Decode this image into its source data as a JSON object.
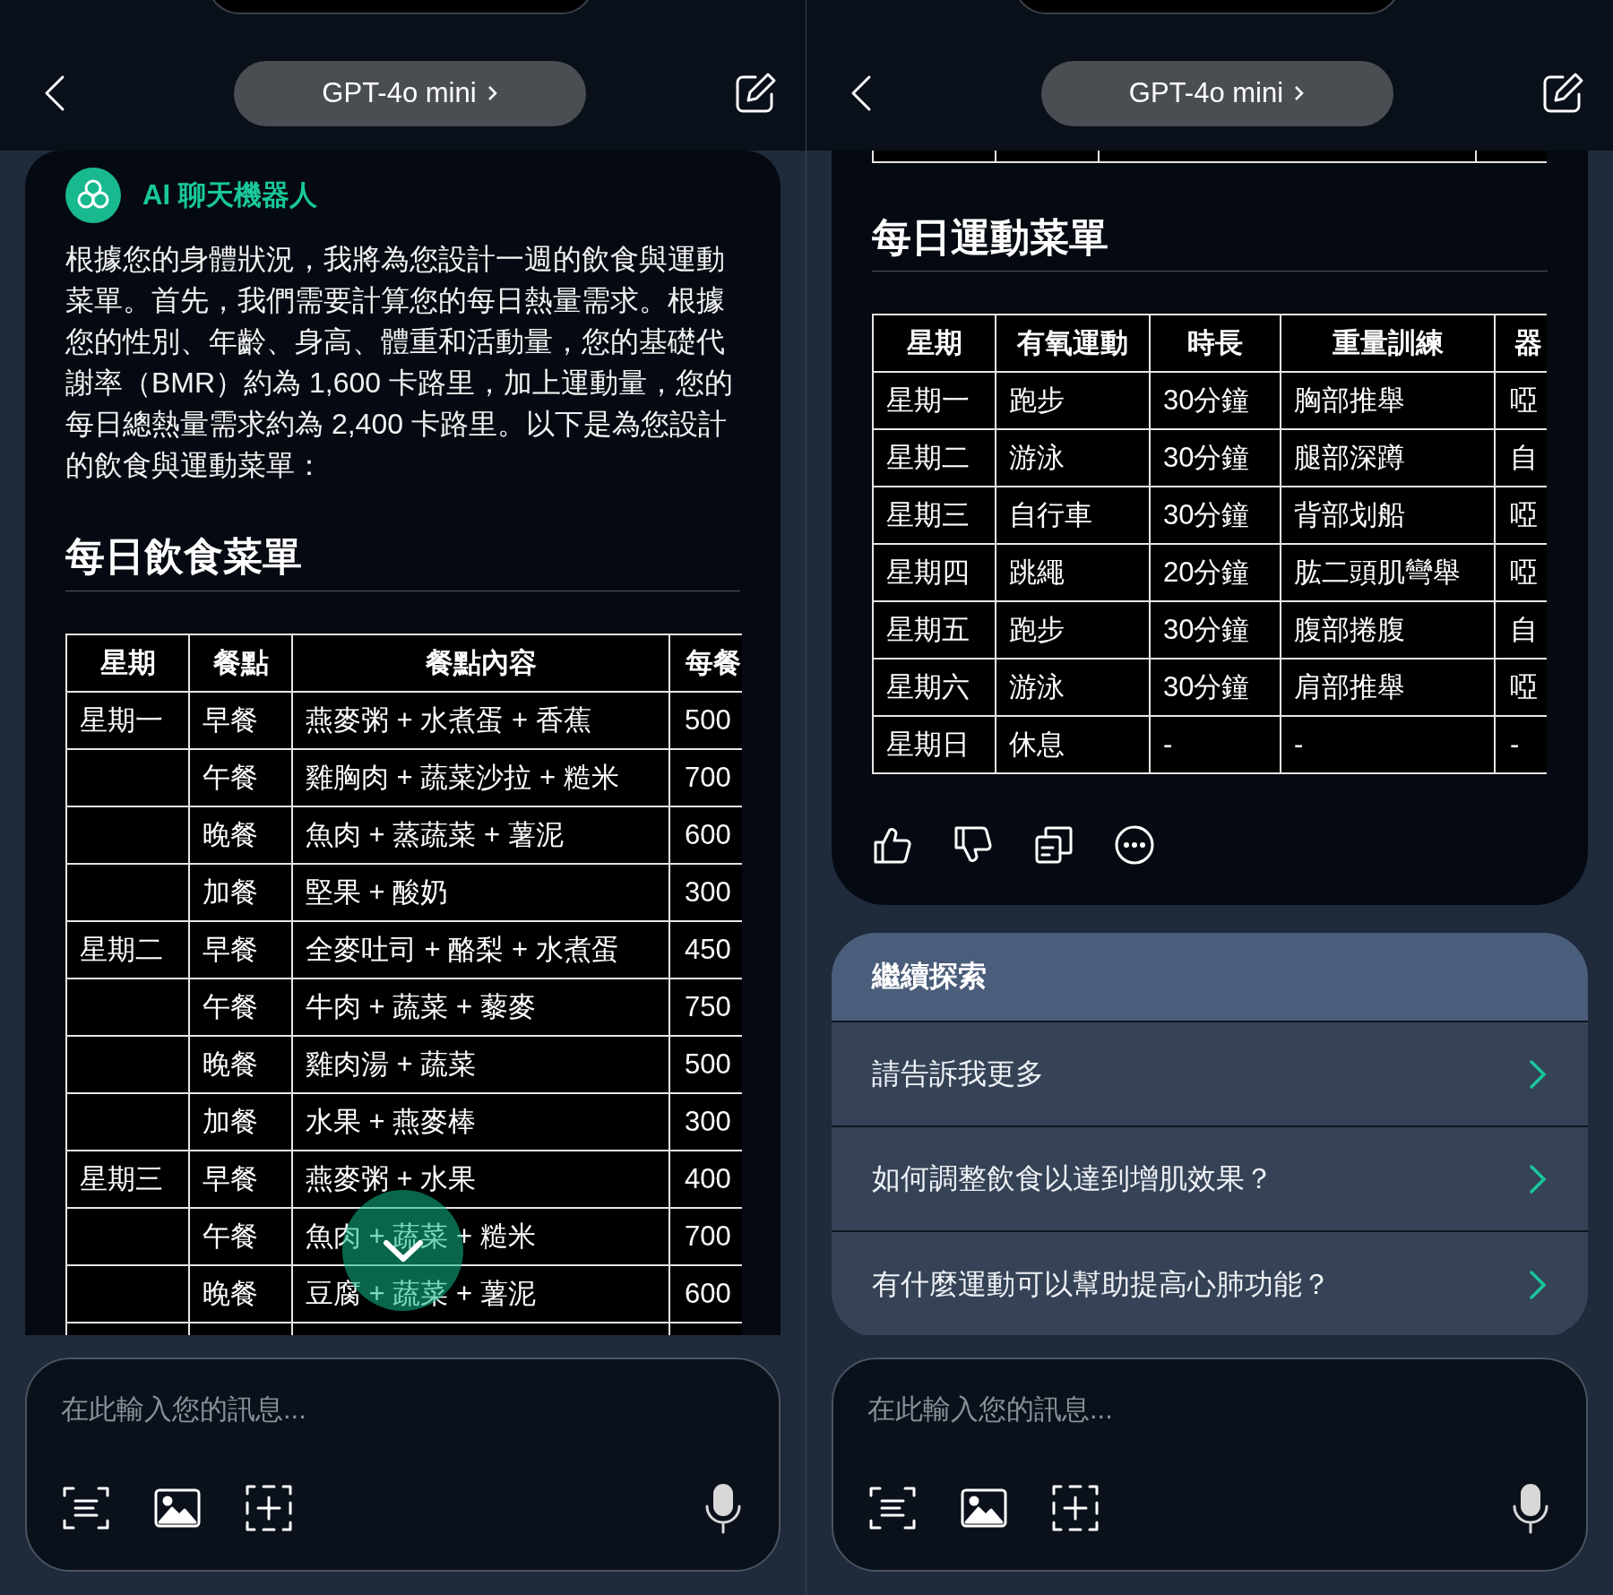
{
  "panes": [
    {
      "header": {
        "model_button": "GPT-4o mini"
      },
      "message": {
        "sender": "AI 聊天機器人",
        "text": "根據您的身體狀況，我將為您設計一週的飲食與運動菜單。首先，我們需要計算您的每日熱量需求。根據您的性別、年齡、身高、體重和活動量，您的基礎代謝率（BMR）約為 1,600 卡路里，加上運動量，您的每日總熱量需求約為 2,400 卡路里。以下是為您設計的飲食與運動菜單：",
        "sections": [
          {
            "kind": "table",
            "heading": "每日飲食菜單",
            "partial_row": true,
            "columns": [
              "星期",
              "餐點",
              "餐點內容",
              "每餐"
            ],
            "rows": [
              [
                "星期一",
                "早餐",
                "燕麥粥 + 水煮蛋 + 香蕉",
                "500"
              ],
              [
                "",
                "午餐",
                "雞胸肉 + 蔬菜沙拉 + 糙米",
                "700"
              ],
              [
                "",
                "晚餐",
                "魚肉 + 蒸蔬菜 + 薯泥",
                "600"
              ],
              [
                "",
                "加餐",
                "堅果 + 酸奶",
                "300"
              ],
              [
                "星期二",
                "早餐",
                "全麥吐司 + 酪梨 + 水煮蛋",
                "450"
              ],
              [
                "",
                "午餐",
                "牛肉 + 蔬菜 + 藜麥",
                "750"
              ],
              [
                "",
                "晚餐",
                "雞肉湯 + 蔬菜",
                "500"
              ],
              [
                "",
                "加餐",
                "水果 + 燕麥棒",
                "300"
              ],
              [
                "星期三",
                "早餐",
                "燕麥粥 + 水果",
                "400"
              ],
              [
                "",
                "午餐",
                "魚肉 + 蔬菜 + 糙米",
                "700"
              ],
              [
                "",
                "晚餐",
                "豆腐 + 蔬菜 + 薯泥",
                "600"
              ]
            ]
          }
        ]
      },
      "scroll_down_button": true,
      "input": {
        "placeholder": "在此輸入您的訊息..."
      }
    },
    {
      "header": {
        "model_button": "GPT-4o mini"
      },
      "message": {
        "feedback_actions": true,
        "sections": [
          {
            "kind": "table_end"
          },
          {
            "kind": "table",
            "heading": "每日運動菜單",
            "columns": [
              "星期",
              "有氧運動",
              "時長",
              "重量訓練",
              "器"
            ],
            "rows": [
              [
                "星期一",
                "跑步",
                "30分鐘",
                "胸部推舉",
                "啞"
              ],
              [
                "星期二",
                "游泳",
                "30分鐘",
                "腿部深蹲",
                "自"
              ],
              [
                "星期三",
                "自行車",
                "30分鐘",
                "背部划船",
                "啞"
              ],
              [
                "星期四",
                "跳繩",
                "20分鐘",
                "肱二頭肌彎舉",
                "啞"
              ],
              [
                "星期五",
                "跑步",
                "30分鐘",
                "腹部捲腹",
                "自"
              ],
              [
                "星期六",
                "游泳",
                "30分鐘",
                "肩部推舉",
                "啞"
              ],
              [
                "星期日",
                "休息",
                "-",
                "-",
                "-"
              ]
            ]
          }
        ]
      },
      "suggestions": {
        "title": "繼續探索",
        "items": [
          "請告訴我更多",
          "如何調整飲食以達到增肌效果？",
          "有什麼運動可以幫助提高心肺功能？"
        ]
      },
      "input": {
        "placeholder": "在此輸入您的訊息..."
      }
    }
  ]
}
